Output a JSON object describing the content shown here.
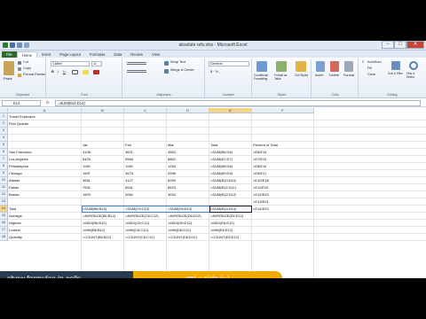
{
  "window": {
    "title": "absolute refs.xlsx - Microsoft Excel"
  },
  "tabs": [
    "File",
    "Home",
    "Insert",
    "Page Layout",
    "Formulas",
    "Data",
    "Review",
    "View"
  ],
  "ribbon": {
    "clipboard": {
      "label": "Clipboard",
      "paste": "Paste",
      "cut": "Cut",
      "copy": "Copy",
      "format_painter": "Format Painter"
    },
    "font": {
      "label": "Font",
      "name": "Calibri",
      "size": "11"
    },
    "alignment": {
      "label": "Alignment",
      "wrap": "Wrap Text",
      "merge": "Merge & Center"
    },
    "number": {
      "label": "Number",
      "format": "General"
    },
    "styles": {
      "label": "Styles",
      "cond": "Conditional Formatting",
      "table": "Format as Table",
      "cell": "Cell Styles"
    },
    "cells": {
      "label": "Cells",
      "insert": "Insert",
      "delete": "Delete",
      "format": "Format"
    },
    "editing": {
      "label": "Editing",
      "autosum": "AutoSum",
      "fill": "Fill",
      "clear": "Clear",
      "sort": "Sort & Filter",
      "find": "Find & Select"
    }
  },
  "formula_bar": {
    "name_box": "E14",
    "fx": "fx",
    "formula": "=SUM(B14:D14)"
  },
  "columns": [
    "A",
    "B",
    "C",
    "D",
    "E",
    "F"
  ],
  "rows": [
    "1",
    "2",
    "3",
    "4",
    "5",
    "6",
    "7",
    "8",
    "9",
    "10",
    "11",
    "12",
    "13",
    "14",
    "15",
    "16",
    "17",
    "18"
  ],
  "cells": {
    "r1": {
      "A": "Travel Expenses"
    },
    "r2": {
      "A": "First Quarter"
    },
    "r5": {
      "B": "Jan",
      "C": "Feb",
      "D": "Mar",
      "E": "Total",
      "F": "Percent of Total"
    },
    "r6": {
      "A": "San Francisco",
      "B": "4108",
      "C": "3621",
      "D": "4563",
      "E": "=SUM(B6:D6)",
      "F": "=E6/E14"
    },
    "r7": {
      "A": "Los Angeles",
      "B": "5425",
      "C": "9568",
      "D": "8862",
      "E": "=SUM(B7:D7)",
      "F": "=E7/E15"
    },
    "r8": {
      "A": "Philadelphia",
      "B": "1198",
      "C": "1198",
      "D": "1253",
      "E": "=SUM(B8:D8)",
      "F": "=E8/E16"
    },
    "r9": {
      "A": "Chicago",
      "B": "1597",
      "C": "3578",
      "D": "2598",
      "E": "=SUM(B9:D9)",
      "F": "=E9/E17"
    },
    "r10": {
      "A": "Atlanta",
      "B": "3651",
      "C": "4127",
      "D": "8259",
      "E": "=SUM(B10:D10)",
      "F": "=E10/E18"
    },
    "r11": {
      "A": "Dallas",
      "B": "7532",
      "C": "6541",
      "D": "8523",
      "E": "=SUM(B11:D11)",
      "F": "=E11/E19"
    },
    "r12": {
      "A": "Boston",
      "B": "1509",
      "C": "2060",
      "D": "3634",
      "E": "=SUM(B12:D12)",
      "F": "=E12/E20"
    },
    "r13": {
      "F": "=E13/E21"
    },
    "r14": {
      "A": "Total",
      "B": "=SUM(B6:B13)",
      "C": "=SUM(C6:C13)",
      "D": "=SUM(D6:D13)",
      "E": "=SUM(B14:D14)",
      "F": "=E14/E22"
    },
    "r15": {
      "A": "Average",
      "B": "=AVERAGE(B6:B12)",
      "C": "=AVERAGE(C6:C12)",
      "D": "=AVERAGE(D6:D12)",
      "E": "=AVERAGE(E6:E12)"
    },
    "r16": {
      "A": "Highest",
      "B": "=MAX(B6:B12)",
      "C": "=MAX(C6:C12)",
      "D": "=MAX(D6:D12)",
      "E": "=MAX(E6:E12)"
    },
    "r17": {
      "A": "Lowest",
      "B": "=MIN(B6:B12)",
      "C": "=MIN(C6:C12)",
      "D": "=MIN(D6:D12)",
      "E": "=MIN(E6:E12)"
    },
    "r18": {
      "A": "Quantity",
      "B": "=COUNT(B6:B12)",
      "C": "=COUNT(C6:C12)",
      "D": "=COUNT(D6:D12)",
      "E": "=COUNT(E6:E12)"
    }
  },
  "caption": {
    "left": "show formulas in cells",
    "right": "ctrl + tilde (~)"
  },
  "colors": {
    "file_tab": "#2d6a2d",
    "selection_header": "#f5d38a",
    "caption_dark": "#2b3b4f",
    "caption_accent": "#f2a900"
  }
}
